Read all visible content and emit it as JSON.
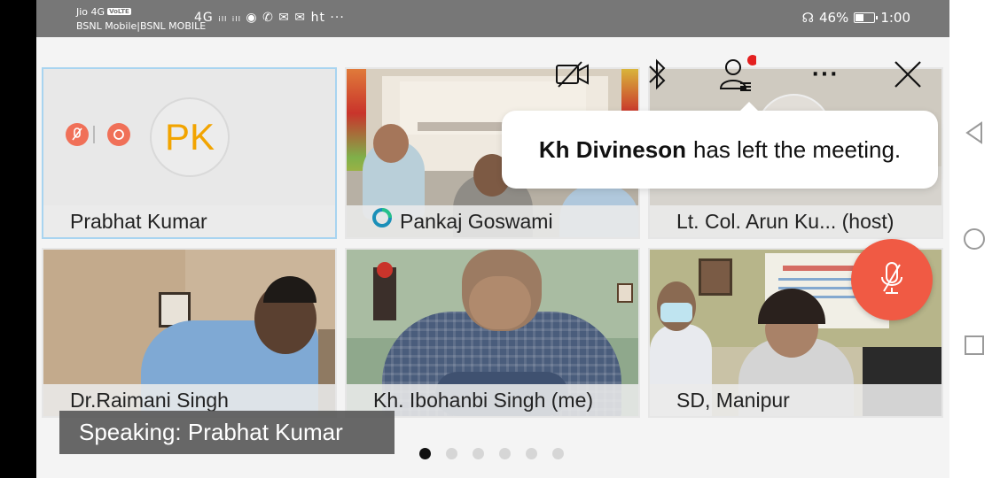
{
  "status_bar": {
    "carrier_line1": "Jio 4G",
    "volte_badge": "VoLTE",
    "carrier_line2": "BSNL Mobile|BSNL MOBILE",
    "notification_icons": "4G ᵢₗₗ ᵢₗₗ ◉ ✆ ✉ ✉ ht ···",
    "battery_percent": "46%",
    "battery_level": 0.46,
    "time": "1:00"
  },
  "top_controls": {
    "video_icon": "video-off-icon",
    "bluetooth_icon": "bluetooth-icon",
    "participants_icon": "participants-icon",
    "more_label": "···",
    "close_icon": "close-icon"
  },
  "toast": {
    "name": "Kh Divineson",
    "message": "has left the meeting."
  },
  "tiles": [
    {
      "name": "Prabhat Kumar",
      "initials": "PK"
    },
    {
      "name": "Pankaj Goswami"
    },
    {
      "name": "Lt. Col.  Arun Ku... (host)"
    },
    {
      "name": "Dr.Raimani Singh"
    },
    {
      "name": "Kh. Ibohanbi Singh (me)"
    },
    {
      "name": "SD, Manipur"
    }
  ],
  "speaking": "Speaking: Prabhat Kumar",
  "pagination": {
    "total": 6,
    "active": 0
  },
  "colors": {
    "accent_red": "#f05a44",
    "initials_orange": "#f2a400",
    "active_border": "#a8d4f0"
  }
}
